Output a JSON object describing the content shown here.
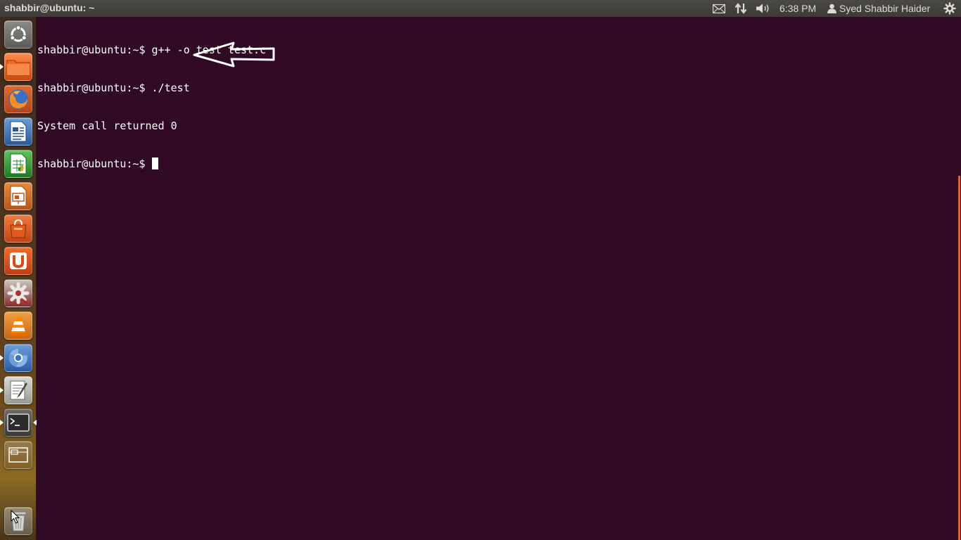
{
  "panel": {
    "window_title": "shabbir@ubuntu: ~",
    "clock": "6:38 PM",
    "user_name": "Syed Shabbir Haider",
    "icons": [
      "mail-icon",
      "network-icon",
      "volume-icon",
      "user-icon",
      "gear-icon"
    ]
  },
  "launcher": {
    "items": [
      {
        "name": "dash-home",
        "icon": "ubuntu-logo-icon"
      },
      {
        "name": "files",
        "icon": "folder-icon",
        "running": true
      },
      {
        "name": "firefox",
        "icon": "firefox-icon"
      },
      {
        "name": "libreoffice-writer",
        "icon": "writer-icon"
      },
      {
        "name": "libreoffice-calc",
        "icon": "calc-icon"
      },
      {
        "name": "libreoffice-impress",
        "icon": "impress-icon"
      },
      {
        "name": "software-center",
        "icon": "shopping-bag-icon"
      },
      {
        "name": "ubuntu-one",
        "icon": "ubuntu-one-icon"
      },
      {
        "name": "system-settings",
        "icon": "settings-gear-icon"
      },
      {
        "name": "vlc",
        "icon": "vlc-cone-icon"
      },
      {
        "name": "chromium",
        "icon": "chromium-icon",
        "running": true
      },
      {
        "name": "text-editor",
        "icon": "text-editor-icon",
        "running": true
      },
      {
        "name": "terminal",
        "icon": "terminal-icon",
        "running": true,
        "focused": true
      },
      {
        "name": "workspace-switcher",
        "icon": "workspace-icon"
      },
      {
        "name": "trash",
        "icon": "trash-icon"
      }
    ]
  },
  "terminal": {
    "lines": [
      "shabbir@ubuntu:~$ g++ -o test test.c",
      "shabbir@ubuntu:~$ ./test",
      "System call returned 0"
    ],
    "prompt": "shabbir@ubuntu:~$ "
  },
  "colors": {
    "terminal_bg": "#300a24",
    "panel_bg": "#3c3b37",
    "text": "#ffffff",
    "accent": "#e0622e"
  }
}
